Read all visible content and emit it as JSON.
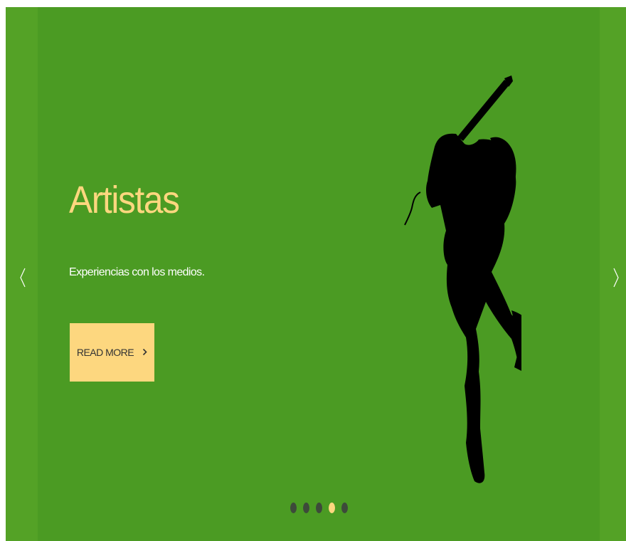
{
  "slide": {
    "title": "Artistas",
    "subtitle": "Experiencias con los medios.",
    "button_label": "READ MORE",
    "button_icon": "chevron-right-icon",
    "image": "guitarist-silhouette-icon"
  },
  "navigation": {
    "prev_icon": "chevron-left-icon",
    "next_icon": "chevron-right-icon"
  },
  "pagination": {
    "total": 5,
    "active_index": 3
  },
  "colors": {
    "outer_background": "#54a226",
    "slide_background": "#4b9b23",
    "accent": "#fdd77f",
    "text_light": "#ffffff",
    "dot_inactive": "#3d4a3a"
  }
}
